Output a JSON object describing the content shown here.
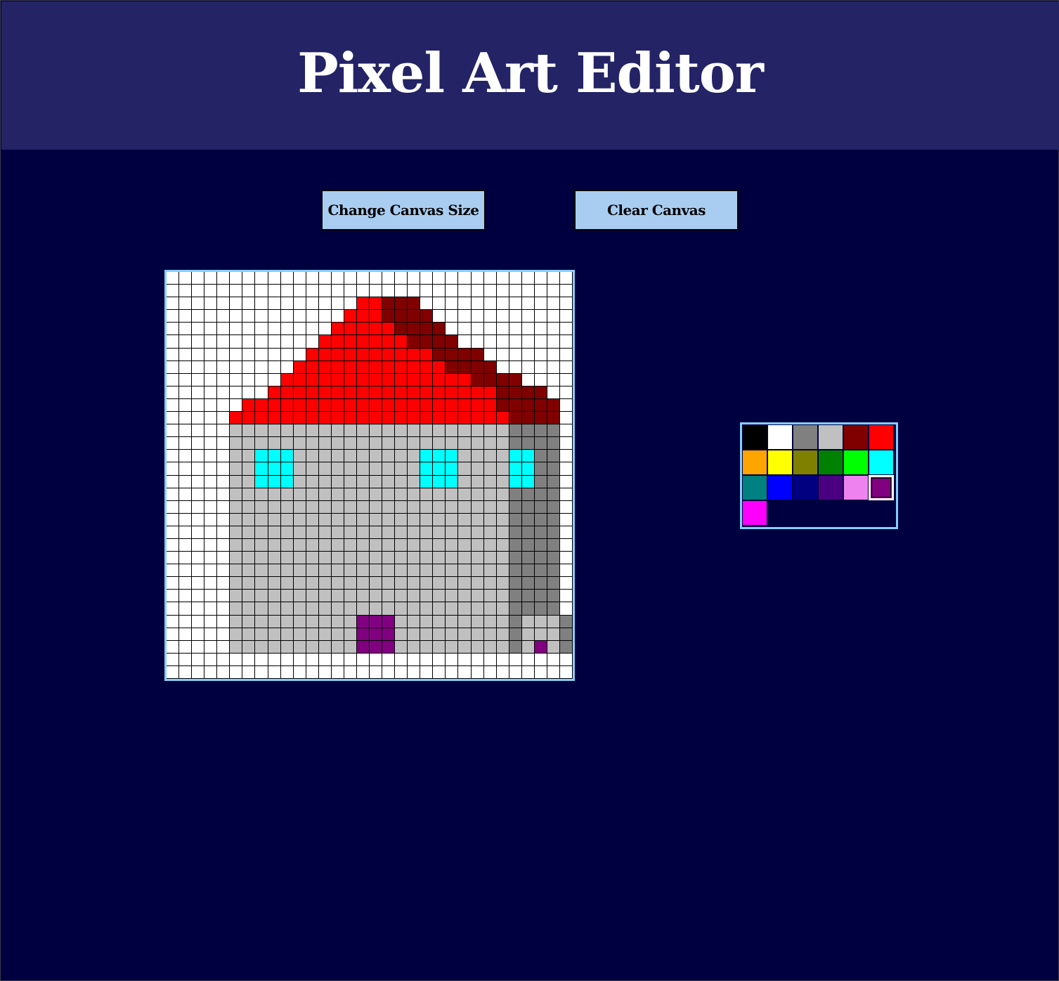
{
  "header": {
    "title": "Pixel Art Editor"
  },
  "toolbar": {
    "resize_label": "Change Canvas Size",
    "clear_label": "Clear Canvas"
  },
  "canvas": {
    "columns": 32,
    "rows": 32,
    "legend": {
      ".": "#ffffff",
      "R": "#ff0000",
      "D": "#800000",
      "S": "#c0c0c0",
      "G": "#808080",
      "C": "#00ffff",
      "P": "#800080"
    },
    "pixels": [
      "................................",
      "................................",
      "...............RRDDD............",
      "..............RRRDDDD...........",
      ".............RRRRRDDDD..........",
      "............RRRRRRRDDDD.........",
      "...........RRRRRRRRRRDDDD.......",
      "..........RRRRRRRRRRRRDDDD......",
      ".........RRRRRRRRRRRRRRRDDDD....",
      "........RRRRRRRRRRRRRRRRRRDDDD..",
      "......RRRRRRRRRRRRRRRRRRRRDDDDD.",
      ".....RRRRRRRRRRRRRRRRRRRRRRDDDD.",
      ".....SSSSSSSSSSSSSSSSSSSSSSGGGG.",
      ".....SSSSSSSSSSSSSSSSSSSSSSGGGG.",
      ".....SSCCCSSSSSSSSSSCCCSSSSCCGG.",
      ".....SSCCCSSSSSSSSSSCCCSSSSCCGG.",
      ".....SSCCCSSSSSSSSSSCCCSSSSCCGG.",
      ".....SSSSSSSSSSSSSSSSSSSSSSGGGG.",
      ".....SSSSSSSSSSSSSSSSSSSSSSGGGG.",
      ".....SSSSSSSSSSSSSSSSSSSSSSGGGG.",
      ".....SSSSSSSSSSSSSSSSSSSSSSGGGG.",
      ".....SSSSSSSSSSSSSSSSSSSSSSGGGG.",
      ".....SSSSSSSSSSSSSSSSSSSSSSGGGG.",
      ".....SSSSSSSSSSSSSSSSSSSSSSGGGG.",
      ".....SSSSSSSSSSSSSSSSSSSSSSGGGG.",
      ".....SSSSSSSSSSSSSSSSSSSSSSGGGG.",
      ".....SSSSSSSSSSSSSSSSSSSSSSGGGG.",
      ".....SSSSSSSSSSPPPSSSSSSSSSGSSSG",
      ".....SSSSSSSSSSPPPSSSSSSSSSGSSSG",
      ".....SSSSSSSSSSPPPSSSSSSSSSGSPSG",
      "................................",
      "................................"
    ]
  },
  "palette": {
    "selected_index": 17,
    "colors": [
      "#000000",
      "#ffffff",
      "#808080",
      "#c0c0c0",
      "#800000",
      "#ff0000",
      "#ffa500",
      "#ffff00",
      "#808000",
      "#008000",
      "#00ff00",
      "#00ffff",
      "#008080",
      "#0000ff",
      "#000080",
      "#4b0082",
      "#ee82ee",
      "#800080",
      "#ff00ff"
    ]
  }
}
